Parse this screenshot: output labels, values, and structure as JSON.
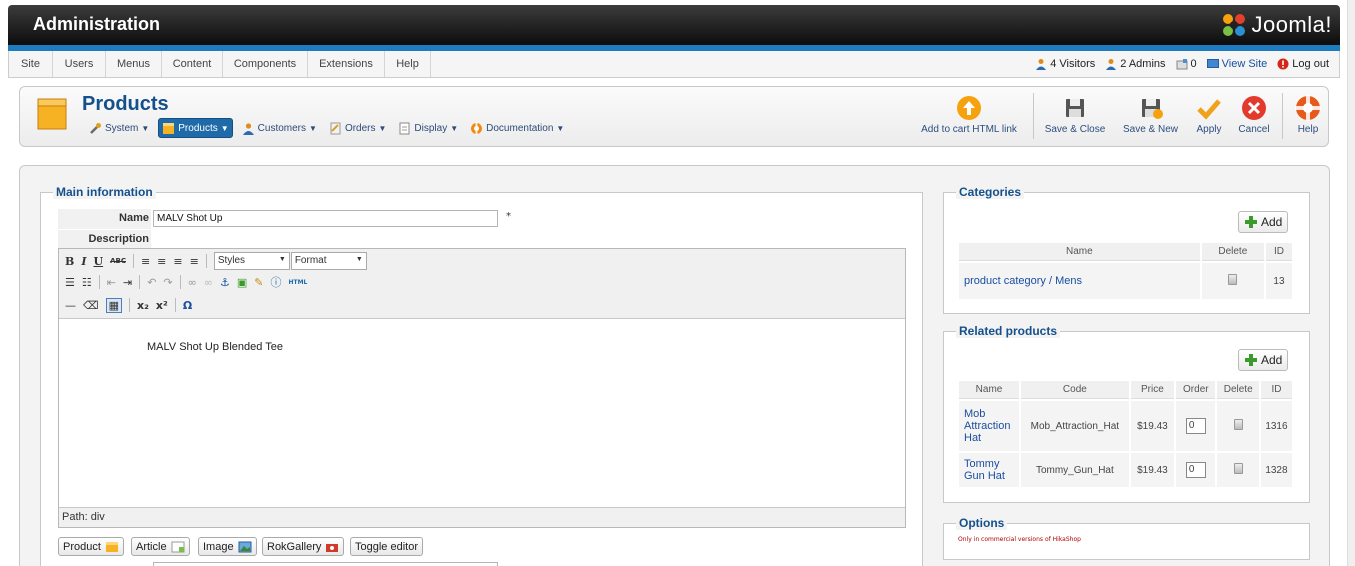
{
  "header": {
    "title": "Administration",
    "logo_text": "Joomla!"
  },
  "menu": {
    "items": [
      "Site",
      "Users",
      "Menus",
      "Content",
      "Components",
      "Extensions",
      "Help"
    ]
  },
  "status": {
    "visitors": "4 Visitors",
    "admins": "2 Admins",
    "messages": "0",
    "view_site": "View Site",
    "logout": "Log out"
  },
  "toolbar": {
    "page_title": "Products",
    "submenu": [
      {
        "label": "System",
        "icon": "tools-icon"
      },
      {
        "label": "Products",
        "icon": "box-icon",
        "active": true
      },
      {
        "label": "Customers",
        "icon": "users-icon"
      },
      {
        "label": "Orders",
        "icon": "orders-icon"
      },
      {
        "label": "Display",
        "icon": "page-icon"
      },
      {
        "label": "Documentation",
        "icon": "lifebuoy-icon"
      }
    ],
    "buttons": {
      "add_to_cart": "Add to cart HTML link",
      "save_close": "Save & Close",
      "save_new": "Save & New",
      "apply": "Apply",
      "cancel": "Cancel",
      "help": "Help"
    }
  },
  "main_info": {
    "legend": "Main information",
    "name_label": "Name",
    "name_value": "MALV Shot Up",
    "required_mark": "*",
    "description_label": "Description",
    "editor": {
      "styles_label": "Styles",
      "format_label": "Format",
      "html_label": "HTML",
      "content": "MALV Shot Up Blended Tee",
      "path": "Path: div"
    },
    "extra_buttons": [
      "Product",
      "Article",
      "Image",
      "RokGallery",
      "Toggle editor"
    ]
  },
  "categories": {
    "legend": "Categories",
    "add_label": "Add",
    "columns": [
      "Name",
      "Delete",
      "ID"
    ],
    "rows": [
      {
        "name": "product category / Mens",
        "id": "13"
      }
    ]
  },
  "related": {
    "legend": "Related products",
    "add_label": "Add",
    "columns": [
      "Name",
      "Code",
      "Price",
      "Order",
      "Delete",
      "ID"
    ],
    "rows": [
      {
        "name": "Mob Attraction Hat",
        "code": "Mob_Attraction_Hat",
        "price": "$19.43",
        "order": "0",
        "id": "1316"
      },
      {
        "name": "Tommy Gun Hat",
        "code": "Tommy_Gun_Hat",
        "price": "$19.43",
        "order": "0",
        "id": "1328"
      }
    ]
  },
  "options": {
    "legend": "Options",
    "note": "Only in commercial versions of HikaShop"
  },
  "colors": {
    "accent_blue": "#1f7bbf",
    "title_blue": "#14508c",
    "link_blue": "#1a4fa0",
    "note_red": "#b00000"
  }
}
